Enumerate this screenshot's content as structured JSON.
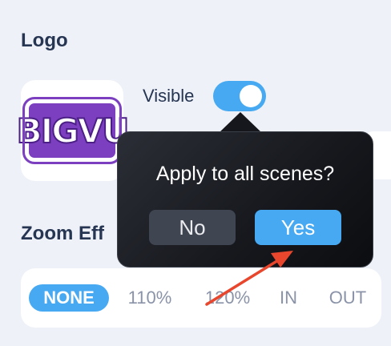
{
  "logo_section": {
    "title": "Logo",
    "logo_text": "BIGVU",
    "visible_label": "Visible",
    "visible_on": true
  },
  "zoom_section": {
    "title": "Zoom Effect",
    "title_visible": "Zoom Eff",
    "options": [
      "NONE",
      "110%",
      "120%",
      "IN",
      "OUT"
    ],
    "selected": "NONE"
  },
  "popup": {
    "question": "Apply to all scenes?",
    "no_label": "No",
    "yes_label": "Yes"
  },
  "colors": {
    "accent": "#47a9f2",
    "title_text": "#263552",
    "popup_bg": "#15171c",
    "logo_purple": "#7b3fbf",
    "annotation_arrow": "#e8472e"
  }
}
